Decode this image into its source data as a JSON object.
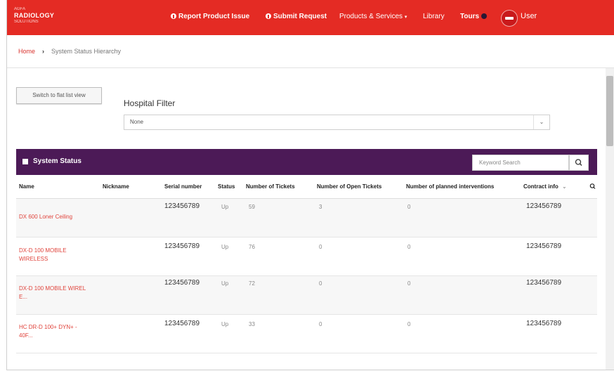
{
  "brand": {
    "line1": "AGFA",
    "line2": "RADIOLOGY",
    "line3": "SOLUTIONS"
  },
  "nav": {
    "report": "Report Product Issue",
    "submit": "Submit Request",
    "products": "Products & Services",
    "library": "Library",
    "tours": "Tours",
    "user": "User"
  },
  "breadcrumb": {
    "home": "Home",
    "current": "System Status Hierarchy"
  },
  "switch_label": "Switch to flat list view",
  "hospital_filter": {
    "label": "Hospital Filter",
    "value": "None"
  },
  "panel": {
    "title": "System Status",
    "search_placeholder": "Keyword Search"
  },
  "columns": [
    "Name",
    "Nickname",
    "Serial number",
    "Status",
    "Number of Tickets",
    "Number of Open Tickets",
    "Number of planned interventions",
    "Contract info"
  ],
  "rows": [
    {
      "name": "DX 600 Loner Ceiling",
      "nickname": "",
      "serial": "123456789",
      "status": "Up",
      "tickets": "59",
      "open": "3",
      "planned": "0",
      "contract": "123456789"
    },
    {
      "name": "DX-D 100 MOBILE WIRELESS",
      "nickname": "",
      "serial": "123456789",
      "status": "Up",
      "tickets": "76",
      "open": "0",
      "planned": "0",
      "contract": "123456789"
    },
    {
      "name": "DX-D 100 MOBILE WIREL E...",
      "nickname": "",
      "serial": "123456789",
      "status": "Up",
      "tickets": "72",
      "open": "0",
      "planned": "0",
      "contract": "123456789"
    },
    {
      "name": "HC DR-D 100+ DYN+ - 40F...",
      "nickname": "",
      "serial": "123456789",
      "status": "Up",
      "tickets": "33",
      "open": "0",
      "planned": "0",
      "contract": "123456789"
    }
  ]
}
